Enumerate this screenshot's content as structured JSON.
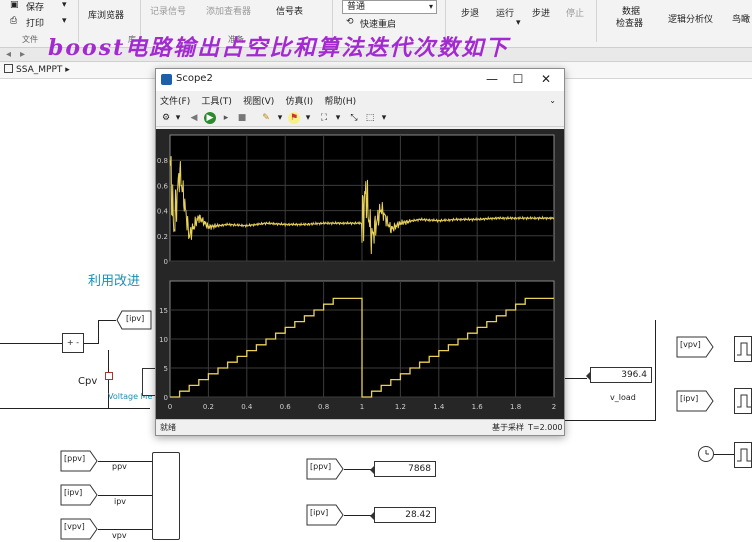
{
  "ribbon": {
    "save": "保存",
    "print": "打印",
    "file_section": "文件",
    "library_browser": "库浏览器",
    "library_section": "库",
    "log_signals": "记录信号",
    "add_viewer": "添加查看器",
    "signal_table": "信号表",
    "prepare_section": "准备",
    "sim_mode": "普通",
    "fast_restart": "快速重启",
    "step_back": "步退",
    "run": "运行",
    "step_forward": "步进",
    "stop": "停止",
    "data_inspector_1": "数据",
    "data_inspector_2": "检查器",
    "logic_analyzer": "逻辑分析仪",
    "bird_eye": "鸟瞰"
  },
  "breadcrumb": "SSA_MPPT",
  "overlay_text": "boost电路输出占空比和算法迭代次数如下",
  "canvas": {
    "heading": "利用改进",
    "cpv": "Cpv",
    "voltage_meas": "Voltage Me",
    "v_load": "v_load",
    "ppv": "ppv",
    "ipv_lbl": "ipv",
    "vpv_lbl": "vpv"
  },
  "gotos": {
    "ipv_top": "[ipv]",
    "vpv_r1": "[vpv]",
    "ipv_r1": "[ipv]",
    "ppv_l1": "[ppv]",
    "ipv_l2": "[ipv]",
    "vpv_l3": "[vpv]",
    "ppv_m1": "[ppv]",
    "ipv_m2": "[ipv]"
  },
  "displays": {
    "v_load": "396.4",
    "ppv": "7868",
    "ipv": "28.42"
  },
  "scope": {
    "title": "Scope2",
    "menu": [
      "文件(F)",
      "工具(T)",
      "视图(V)",
      "仿真(I)",
      "帮助(H)"
    ],
    "status_left": "就绪",
    "status_mid": "基于采样",
    "status_right": "T=2.000",
    "trace_color": "#e8d25a",
    "bg_color": "#000000"
  },
  "chart_data": [
    {
      "type": "line",
      "x_range": [
        0,
        2
      ],
      "ylim": [
        0,
        1
      ],
      "yticks": [
        "0",
        "0.2",
        "0.4",
        "0.6",
        "0.8"
      ],
      "grid": true,
      "series": [
        {
          "x": [
            0,
            0.02,
            0.05,
            0.1,
            0.15,
            0.2,
            0.3,
            0.4,
            0.5,
            0.6,
            0.7,
            0.8,
            0.9,
            1.0,
            1.02,
            1.05,
            1.1,
            1.15,
            1.2,
            1.3,
            1.4,
            1.5,
            1.6,
            1.7,
            1.8,
            1.9,
            2.0
          ],
          "y": [
            0.8,
            0.25,
            0.72,
            0.2,
            0.35,
            0.27,
            0.29,
            0.28,
            0.3,
            0.29,
            0.29,
            0.3,
            0.3,
            0.3,
            0.55,
            0.18,
            0.42,
            0.25,
            0.3,
            0.33,
            0.32,
            0.33,
            0.33,
            0.34,
            0.34,
            0.34,
            0.34
          ]
        }
      ]
    },
    {
      "type": "line",
      "x_range": [
        0,
        2
      ],
      "xticks": [
        "0",
        "0.2",
        "0.4",
        "0.6",
        "0.8",
        "1",
        "1.2",
        "1.4",
        "1.6",
        "1.8",
        "2"
      ],
      "ylim": [
        0,
        20
      ],
      "yticks": [
        "0",
        "5",
        "10",
        "15"
      ],
      "grid": true,
      "step": true,
      "series": [
        {
          "x": [
            0,
            0.05,
            0.1,
            0.15,
            0.2,
            0.25,
            0.3,
            0.35,
            0.4,
            0.45,
            0.5,
            0.55,
            0.6,
            0.65,
            0.7,
            0.75,
            0.8,
            0.85,
            0.9,
            1.0,
            1.05,
            1.1,
            1.15,
            1.2,
            1.25,
            1.3,
            1.35,
            1.4,
            1.45,
            1.5,
            1.55,
            1.6,
            1.65,
            1.7,
            1.75,
            1.8,
            1.85,
            2.0
          ],
          "y": [
            0,
            1,
            2,
            3,
            4,
            5,
            6,
            7,
            8,
            9,
            10,
            11,
            12,
            13,
            14,
            15,
            16,
            17,
            17,
            0,
            1,
            2,
            3,
            4,
            5,
            6,
            7,
            8,
            9,
            10,
            11,
            12,
            13,
            14,
            15,
            16,
            17,
            17
          ]
        }
      ]
    }
  ]
}
